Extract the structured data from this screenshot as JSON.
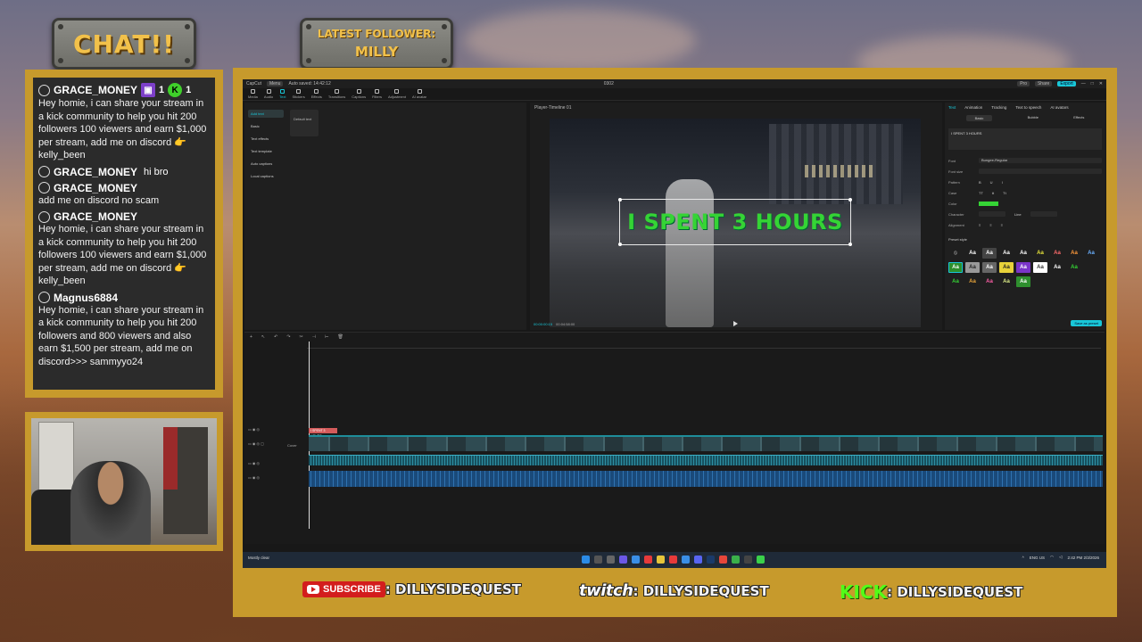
{
  "overlay": {
    "chat_sign": "CHAT!!",
    "follower_sign": {
      "line1": "LATEST FOLLOWER:",
      "line2": "MILLY"
    }
  },
  "chat": {
    "twitch_count": "1",
    "kick_count": "1",
    "messages": [
      {
        "user": "GRACE_MONEY",
        "text": "Hey homie, i can share your stream in a kick community to help you hit 200 followers 100 viewers and earn $1,000 per stream, add me on discord 👉 kelly_been"
      },
      {
        "user": "GRACE_MONEY",
        "text": "hi bro"
      },
      {
        "user": "GRACE_MONEY",
        "text": "add me on discord no scam"
      },
      {
        "user": "GRACE_MONEY",
        "text": "Hey homie, i can share your stream in a kick community to help you hit 200 followers 100 viewers and earn $1,000 per stream, add me on discord 👉 kelly_been"
      },
      {
        "user": "Magnus6884",
        "text": "Hey homie, i can share your stream in a kick community to help you hit 200 followers and 800 viewers and also earn $1,500 per stream, add me on discord>>> sammyyo24"
      }
    ]
  },
  "capcut": {
    "app_name": "CapCut",
    "menu": "Menu",
    "autosave": "Auto saved: 14:42:12",
    "project": "0302",
    "pro": "Pro",
    "share": "Share",
    "export": "Export",
    "tools": [
      "Media",
      "Audio",
      "Text",
      "Stickers",
      "Effects",
      "Transitions",
      "Captions",
      "Filters",
      "Adjustment",
      "AI avatar"
    ],
    "left_list": [
      "Add text",
      "Basic",
      "Text effects",
      "Text template",
      "Auto captions",
      "Local captions"
    ],
    "default_text": "Default text",
    "player_title": "Player-Timeline 01",
    "caption": "I SPENT 3 HOURS",
    "time_current": "00:00:00:15",
    "time_total": "00:04:58:00",
    "right_tabs": [
      "Text",
      "Animation",
      "Tracking",
      "Text to speech",
      "AI avatars"
    ],
    "right_sub": [
      "Basic",
      "Bubble",
      "Effects"
    ],
    "text_value": "I SPENT 3 HOURS",
    "font_label": "Font",
    "font_value": "Bungee-Regular",
    "font_size_label": "Font size",
    "pattern_label": "Pattern",
    "case_label": "Case",
    "color_label": "Color",
    "character_label": "Character",
    "line_label": "Line",
    "alignment_label": "Alignment",
    "preset_label": "Preset style",
    "save_preset": "Save as preset",
    "text_clip": "I SPENT 3 HOURS",
    "cover": "Cover",
    "accent": "#19c7d8",
    "caption_color": "#35d435"
  },
  "taskbar": {
    "weather": "Mostly clear",
    "lang": "ENG",
    "region": "US",
    "time": "2:42 PM",
    "date": "2/3/2026"
  },
  "socials": {
    "youtube_badge": "SUBSCRIBE",
    "youtube_handle": ": DILLYSIDEQUEST",
    "twitch_logo": "twitch",
    "twitch_handle": ": DILLYSIDEQUEST",
    "kick_logo": "KICK",
    "kick_handle": ": DILLYSIDEQUEST"
  }
}
